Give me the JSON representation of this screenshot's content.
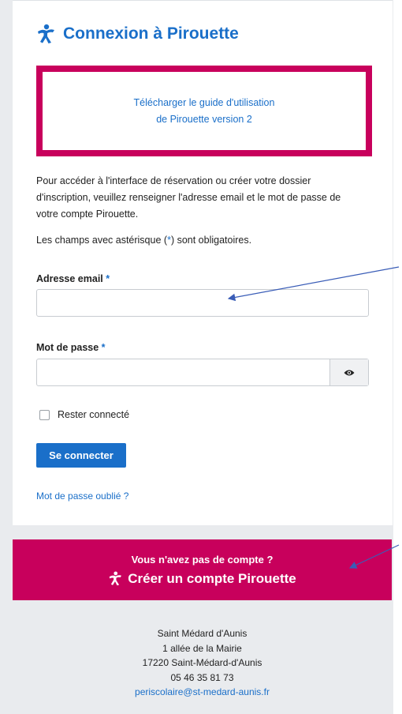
{
  "title": "Connexion à Pirouette",
  "guide": {
    "line1": "Télécharger le guide d'utilisation",
    "line2": "de Pirouette version 2"
  },
  "intro": {
    "line1": "Pour accéder à l'interface de réservation ou créer votre dossier",
    "line2": "d'inscription, veuillez renseigner l'adresse email et le mot de passe de",
    "line3": "votre compte Pirouette."
  },
  "required_note": {
    "before": "Les champs avec astérisque (",
    "star": "*",
    "after": ") sont obligatoires."
  },
  "email_field": {
    "label": "Adresse email",
    "star": "*",
    "value": "",
    "placeholder": ""
  },
  "password_field": {
    "label": "Mot de passe",
    "star": "*",
    "value": "",
    "placeholder": ""
  },
  "remember_label": "Rester connecté",
  "login_button": "Se connecter",
  "forgot_link": "Mot de passe oublié ?",
  "create_account": {
    "question": "Vous n'avez pas de compte ?",
    "label": "Créer un compte Pirouette"
  },
  "footer": {
    "name": "Saint Médard d'Aunis",
    "street": "1 allée de la Mairie",
    "city": "17220 Saint-Médard-d'Aunis",
    "phone": "05 46 35 81 73",
    "email": "periscolaire@st-medard-aunis.fr"
  },
  "colors": {
    "accent_blue": "#1a6fc9",
    "brand_magenta": "#c8005c",
    "background": "#e9ebee"
  },
  "icons": [
    "pirouette-logo-icon",
    "eye-icon",
    "annotation-arrow"
  ]
}
